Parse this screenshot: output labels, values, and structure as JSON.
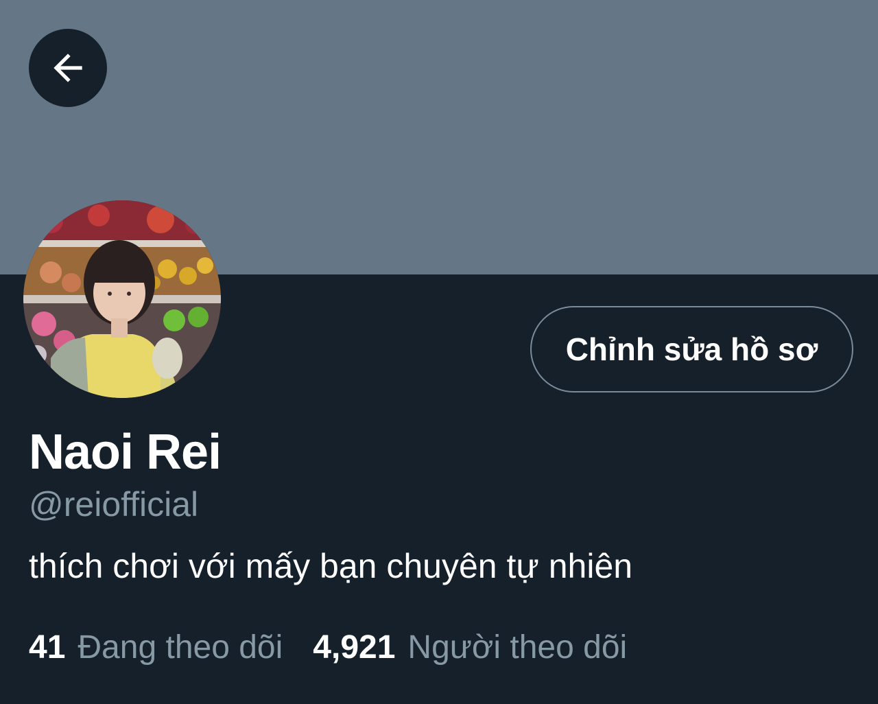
{
  "colors": {
    "banner": "#657786",
    "background": "#15202b",
    "text_primary": "#ffffff",
    "text_secondary": "#8899a6",
    "button_border": "#7a8c9c"
  },
  "header": {
    "back_icon": "arrow-left-icon"
  },
  "profile": {
    "avatar_icon": "profile-photo",
    "edit_button_label": "Chỉnh sửa hồ sơ",
    "display_name": "Naoi Rei",
    "handle": "@reiofficial",
    "bio": "thích chơi với mấy bạn chuyên tự nhiên"
  },
  "stats": {
    "following_count": "41",
    "following_label": "Đang theo dõi",
    "followers_count": "4,921",
    "followers_label": "Người theo dõi"
  }
}
